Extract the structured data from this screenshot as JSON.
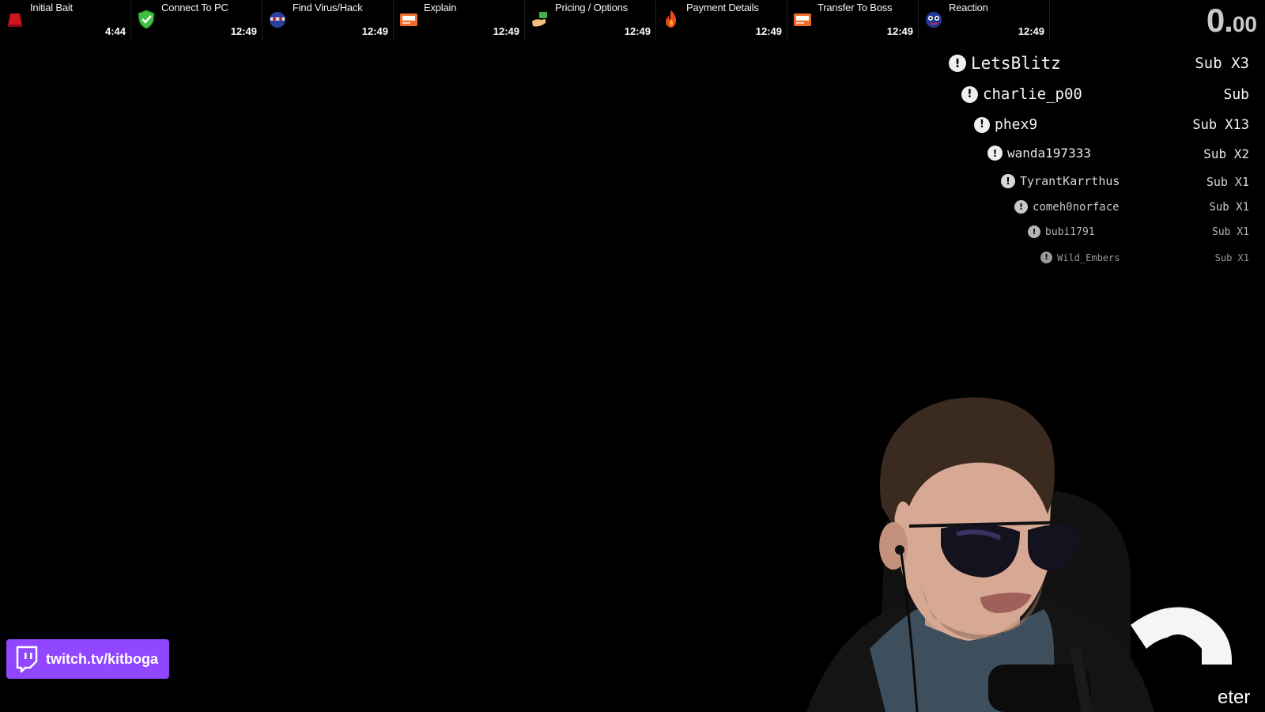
{
  "splits": [
    {
      "name": "Initial Bait",
      "time": "4:44",
      "icon": "red-fez-icon"
    },
    {
      "name": "Connect To PC",
      "time": "12:49",
      "icon": "safe-shield-icon"
    },
    {
      "name": "Find Virus/Hack",
      "time": "12:49",
      "icon": "virus-face-icon"
    },
    {
      "name": "Explain",
      "time": "12:49",
      "icon": "envelope-icon"
    },
    {
      "name": "Pricing / Options",
      "time": "12:49",
      "icon": "money-hand-icon"
    },
    {
      "name": "Payment Details",
      "time": "12:49",
      "icon": "fire-icon"
    },
    {
      "name": "Transfer To Boss",
      "time": "12:49",
      "icon": "envelope-icon"
    },
    {
      "name": "Reaction",
      "time": "12:49",
      "icon": "face-icon"
    }
  ],
  "timer": {
    "main": "0.",
    "fraction": "00"
  },
  "sub_alerts": [
    {
      "user": "LetsBlitz",
      "label": "Sub X3"
    },
    {
      "user": "charlie_p00",
      "label": "Sub"
    },
    {
      "user": "phex9",
      "label": "Sub X13"
    },
    {
      "user": "wanda197333",
      "label": "Sub X2"
    },
    {
      "user": "TyrantKarrthus",
      "label": "Sub X1"
    },
    {
      "user": "comeh0norface",
      "label": "Sub X1"
    },
    {
      "user": "bubi1791",
      "label": "Sub X1"
    },
    {
      "user": "Wild_Embers",
      "label": "Sub X1"
    }
  ],
  "twitch": {
    "url": "twitch.tv/kitboga",
    "icon": "twitch-logo-icon",
    "color": "#9146ff"
  },
  "overlay_fragment": "eter"
}
